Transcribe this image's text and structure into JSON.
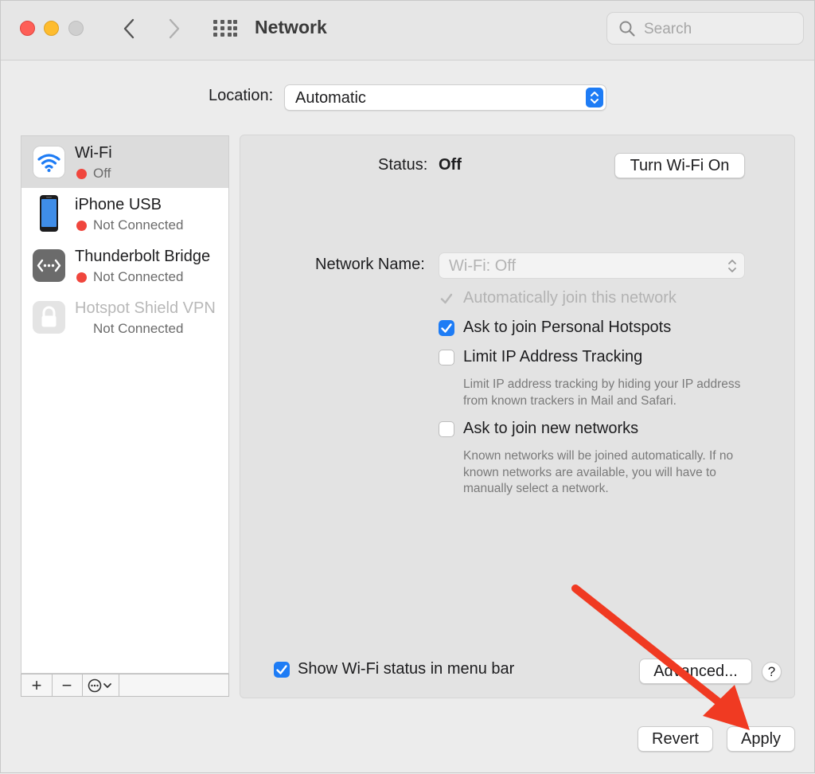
{
  "window": {
    "title": "Network",
    "search_placeholder": "Search"
  },
  "location": {
    "label": "Location:",
    "value": "Automatic"
  },
  "services": [
    {
      "name": "Wi-Fi",
      "status": "Off",
      "status_dot": "red",
      "selected": true,
      "icon": "wifi-icon"
    },
    {
      "name": "iPhone USB",
      "status": "Not Connected",
      "status_dot": "red",
      "icon": "iphone-icon"
    },
    {
      "name": "Thunderbolt Bridge",
      "status": "Not Connected",
      "status_dot": "red",
      "icon": "thunderbolt-bridge-icon"
    },
    {
      "name": "Hotspot Shield VPN",
      "status": "Not Connected",
      "status_dot": "none",
      "icon": "lock-icon"
    }
  ],
  "sidebar_toolbar": {
    "add": "+",
    "remove": "−"
  },
  "detail": {
    "status_label": "Status:",
    "status_value": "Off",
    "turn_on_button": "Turn Wi-Fi On",
    "network_name_label": "Network Name:",
    "network_name_value": "Wi-Fi: Off",
    "auto_join_label": "Automatically join this network",
    "ask_hotspots_label": "Ask to join Personal Hotspots",
    "limit_ip_label": "Limit IP Address Tracking",
    "limit_ip_help": "Limit IP address tracking by hiding your IP address from known trackers in Mail and Safari.",
    "ask_new_label": "Ask to join new networks",
    "ask_new_help": "Known networks will be joined automatically. If no known networks are available, you will have to manually select a network.",
    "show_status_label": "Show Wi-Fi status in menu bar",
    "advanced_button": "Advanced...",
    "help_button": "?"
  },
  "footer": {
    "revert_button": "Revert",
    "apply_button": "Apply"
  },
  "colors": {
    "accent": "#1e7cf5",
    "status_off": "#f0463d",
    "annotation_arrow": "#f03a22"
  }
}
